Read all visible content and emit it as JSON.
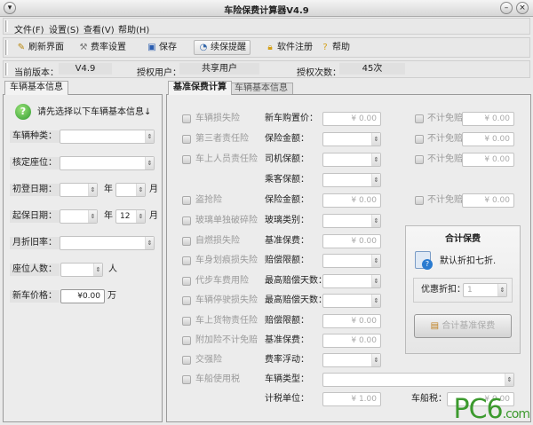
{
  "window": {
    "title": "车险保费计算器V4.9"
  },
  "menu": [
    "文件(F)",
    "设置(S)",
    "查看(V)",
    "帮助(H)"
  ],
  "toolbar": [
    {
      "label": "刷新界面",
      "icon": "broom-icon"
    },
    {
      "label": "费率设置",
      "icon": "tools-icon"
    },
    {
      "label": "保存",
      "icon": "save-icon"
    },
    {
      "label": "续保提醒",
      "icon": "clock-icon"
    },
    {
      "label": "软件注册",
      "icon": "lock-icon"
    },
    {
      "label": "帮助",
      "icon": "help-icon"
    }
  ],
  "info": {
    "version_label": "当前版本：",
    "version": "V4.9",
    "user_label": "授权用户：",
    "user": "共享用户",
    "count_label": "授权次数：",
    "count": "45次"
  },
  "left": {
    "tab": "车辆基本信息",
    "hint": "请先选择以下车辆基本信息↓",
    "vehicle_type": "车辆种类：",
    "seats": "核定座位：",
    "reg_date": "初登日期：",
    "start_date": "起保日期：",
    "year": "年",
    "month": "月",
    "start_month": "12",
    "depreciation": "月折旧率：",
    "passengers": "座位人数：",
    "person": "人",
    "price_label": "新车价格：",
    "price": "¥0.00",
    "wan": "万"
  },
  "right": {
    "tabs": [
      "基准保费计算",
      "车辆基本信息"
    ],
    "rows": [
      {
        "ins": "车辆损失险",
        "field": "新车购置价：",
        "kind": "input",
        "value": "¥ 0.00",
        "extra": "不计免赔",
        "extra_value": "¥ 0.00"
      },
      {
        "ins": "第三者责任险",
        "field": "保险金额：",
        "kind": "combo",
        "extra": "不计免赔",
        "extra_value": "¥ 0.00"
      },
      {
        "ins": "车上人员责任险",
        "field": "司机保额：",
        "kind": "combo",
        "extra": "不计免赔",
        "extra_value": "¥ 0.00"
      },
      {
        "ins": "",
        "field": "乘客保额：",
        "kind": "combo"
      },
      {
        "ins": "盗抢险",
        "field": "保险金额：",
        "kind": "input",
        "value": "¥ 0.00",
        "extra": "不计免赔",
        "extra_value": "¥ 0.00"
      },
      {
        "ins": "玻璃单独破碎险",
        "field": "玻璃类别：",
        "kind": "combo"
      },
      {
        "ins": "自燃损失险",
        "field": "基准保费：",
        "kind": "input",
        "value": "¥ 0.00"
      },
      {
        "ins": "车身划痕损失险",
        "field": "赔偿限额：",
        "kind": "combo"
      },
      {
        "ins": "代步车费用险",
        "field": "最高赔偿天数：",
        "kind": "combo"
      },
      {
        "ins": "车辆停驶损失险",
        "field": "最高赔偿天数：",
        "kind": "combo"
      },
      {
        "ins": "车上货物责任险",
        "field": "赔偿限额：",
        "kind": "input",
        "value": "¥ 0.00"
      },
      {
        "ins": "附加险不计免赔",
        "field": "基准保费：",
        "kind": "input",
        "value": "¥ 0.00"
      },
      {
        "ins": "交强险",
        "field": "费率浮动：",
        "kind": "combo"
      },
      {
        "ins": "车船使用税",
        "field": "车辆类型：",
        "kind": "wide"
      },
      {
        "ins": "",
        "field": "计税单位：",
        "kind": "input",
        "value": "¥ 1.00",
        "extra2": "车船税：",
        "extra2_value": "¥ 0.00"
      }
    ],
    "total": {
      "title": "合计保费",
      "note": "默认折扣七折.",
      "discount_label": "优惠折扣：",
      "discount": "1",
      "button": "合计基准保费"
    }
  },
  "watermark": "PC6.com 下载"
}
